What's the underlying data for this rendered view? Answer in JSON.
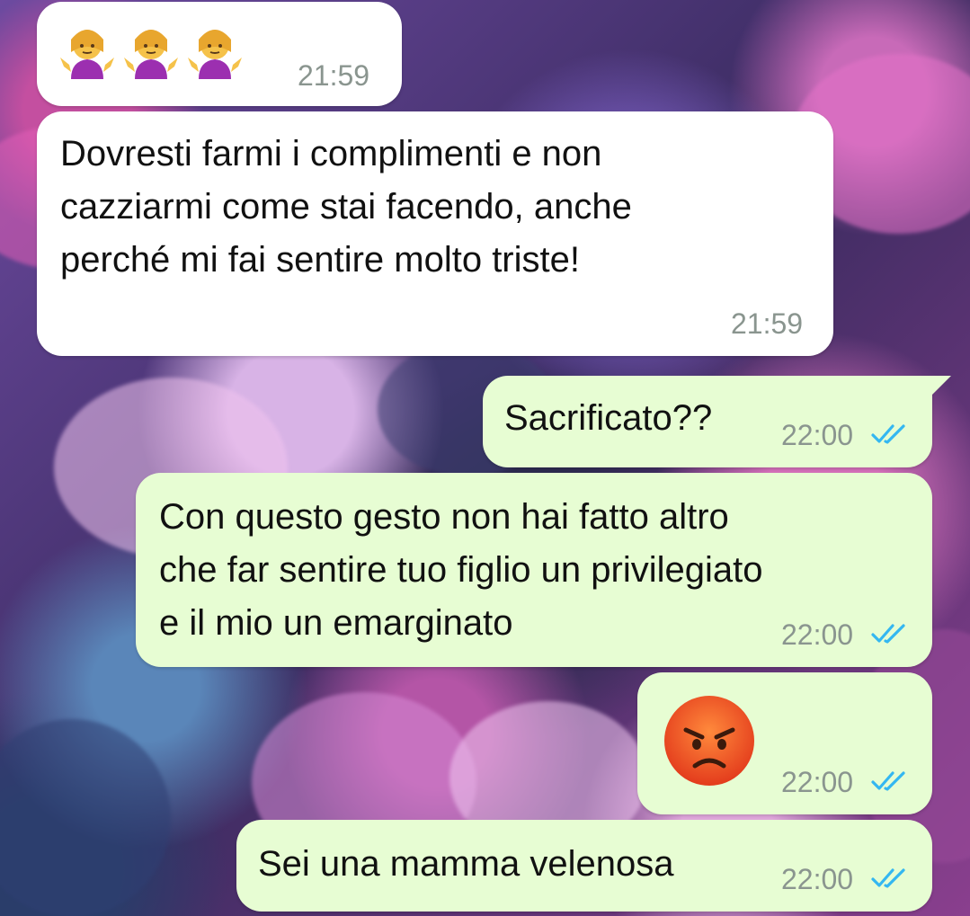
{
  "conversation": {
    "messages": [
      {
        "direction": "incoming",
        "text": "",
        "emoji": [
          "person-gesturing-shrug",
          "person-gesturing-shrug",
          "person-gesturing-shrug"
        ],
        "time": "21:59"
      },
      {
        "direction": "incoming",
        "text": "Dovresti farmi i complimenti e non\ncazziarmi come stai facendo, anche\nperché mi fai sentire molto triste!",
        "time": "21:59"
      },
      {
        "direction": "outgoing",
        "text": "Sacrificato??",
        "time": "22:00",
        "status": "read"
      },
      {
        "direction": "outgoing",
        "text": "Con questo gesto non hai fatto altro\nche far sentire tuo figlio un privilegiato\ne il mio un emarginato",
        "time": "22:00",
        "status": "read"
      },
      {
        "direction": "outgoing",
        "text": "",
        "emoji": [
          "pouting-face"
        ],
        "time": "22:00",
        "status": "read"
      },
      {
        "direction": "outgoing",
        "text": "Sei una mamma velenosa",
        "time": "22:00",
        "status": "read"
      }
    ]
  },
  "colors": {
    "incoming_bubble": "#ffffff",
    "outgoing_bubble": "#e7fdd3",
    "read_ticks": "#34b7f1",
    "timestamp": "#8a958f"
  },
  "icons": {
    "read_receipt": "double-check-icon"
  }
}
